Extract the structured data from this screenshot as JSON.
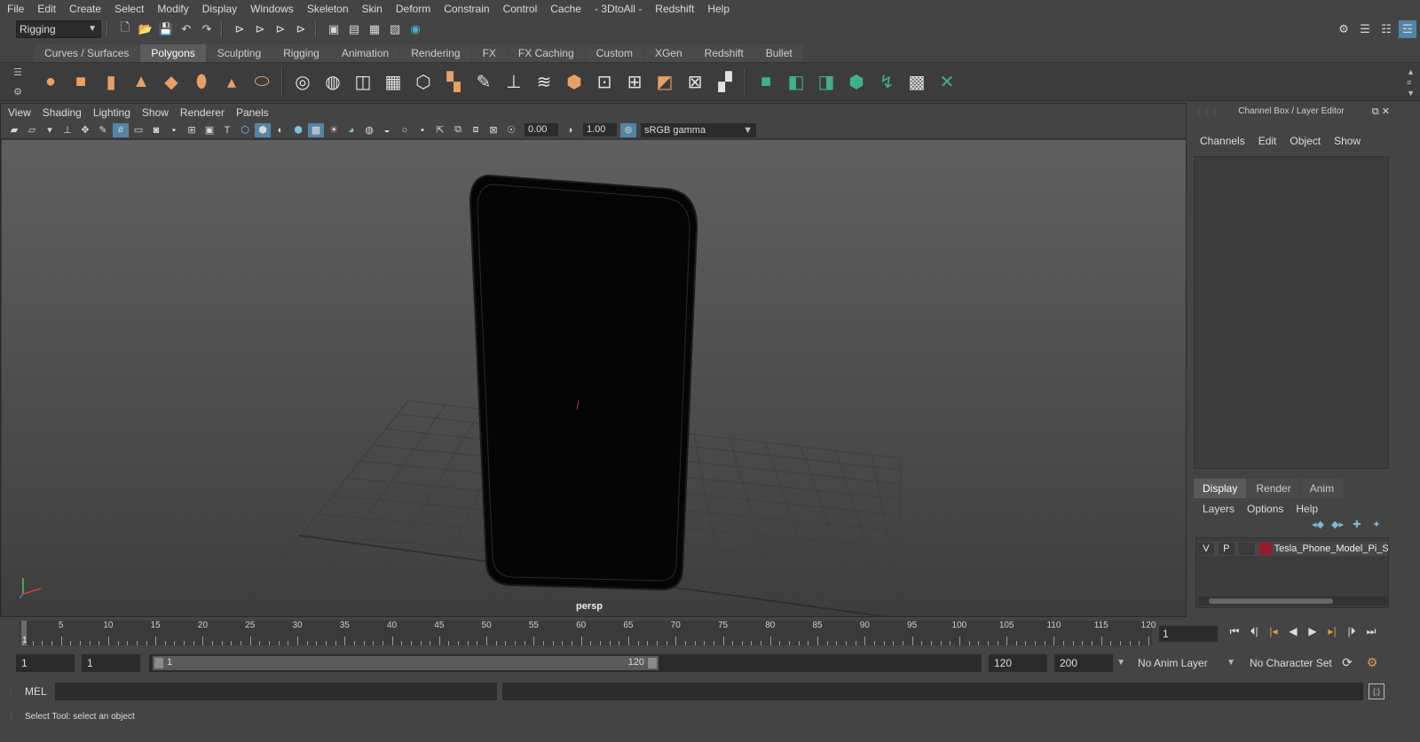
{
  "menubar": [
    "File",
    "Edit",
    "Create",
    "Select",
    "Modify",
    "Display",
    "Windows",
    "Skeleton",
    "Skin",
    "Deform",
    "Constrain",
    "Control",
    "Cache",
    "- 3DtoAll -",
    "Redshift",
    "Help"
  ],
  "statusline": {
    "menuset": "Rigging"
  },
  "shelf": {
    "tabs": [
      "Curves / Surfaces",
      "Polygons",
      "Sculpting",
      "Rigging",
      "Animation",
      "Rendering",
      "FX",
      "FX Caching",
      "Custom",
      "XGen",
      "Redshift",
      "Bullet"
    ],
    "active_tab": "Polygons"
  },
  "viewport": {
    "menu": [
      "View",
      "Shading",
      "Lighting",
      "Show",
      "Renderer",
      "Panels"
    ],
    "exposure": "0.00",
    "gamma": "1.00",
    "color_space": "sRGB gamma",
    "camera_label": "persp"
  },
  "channel_box": {
    "title": "Channel Box / Layer Editor",
    "menu": [
      "Channels",
      "Edit",
      "Object",
      "Show"
    ]
  },
  "layer_editor": {
    "tabs": [
      "Display",
      "Render",
      "Anim"
    ],
    "active_tab": "Display",
    "menu": [
      "Layers",
      "Options",
      "Help"
    ],
    "layer": {
      "v": "V",
      "p": "P",
      "name": "Tesla_Phone_Model_Pi_S",
      "color": "#9a1a2a"
    }
  },
  "time_slider": {
    "current_marker": "1",
    "tick_labels": [
      "5",
      "10",
      "15",
      "20",
      "25",
      "30",
      "35",
      "40",
      "45",
      "50",
      "55",
      "60",
      "65",
      "70",
      "75",
      "80",
      "85",
      "90",
      "95",
      "100",
      "105",
      "110",
      "115",
      "120"
    ],
    "current_frame": "1"
  },
  "range_slider": {
    "start": "1",
    "playback_start": "1",
    "range_start_label": "1",
    "range_end_label": "120",
    "playback_end": "120",
    "end": "200",
    "anim_layer": "No Anim Layer",
    "character_set": "No Character Set"
  },
  "command_line": {
    "language": "MEL"
  },
  "help_line": {
    "text": "Select Tool: select an object"
  }
}
